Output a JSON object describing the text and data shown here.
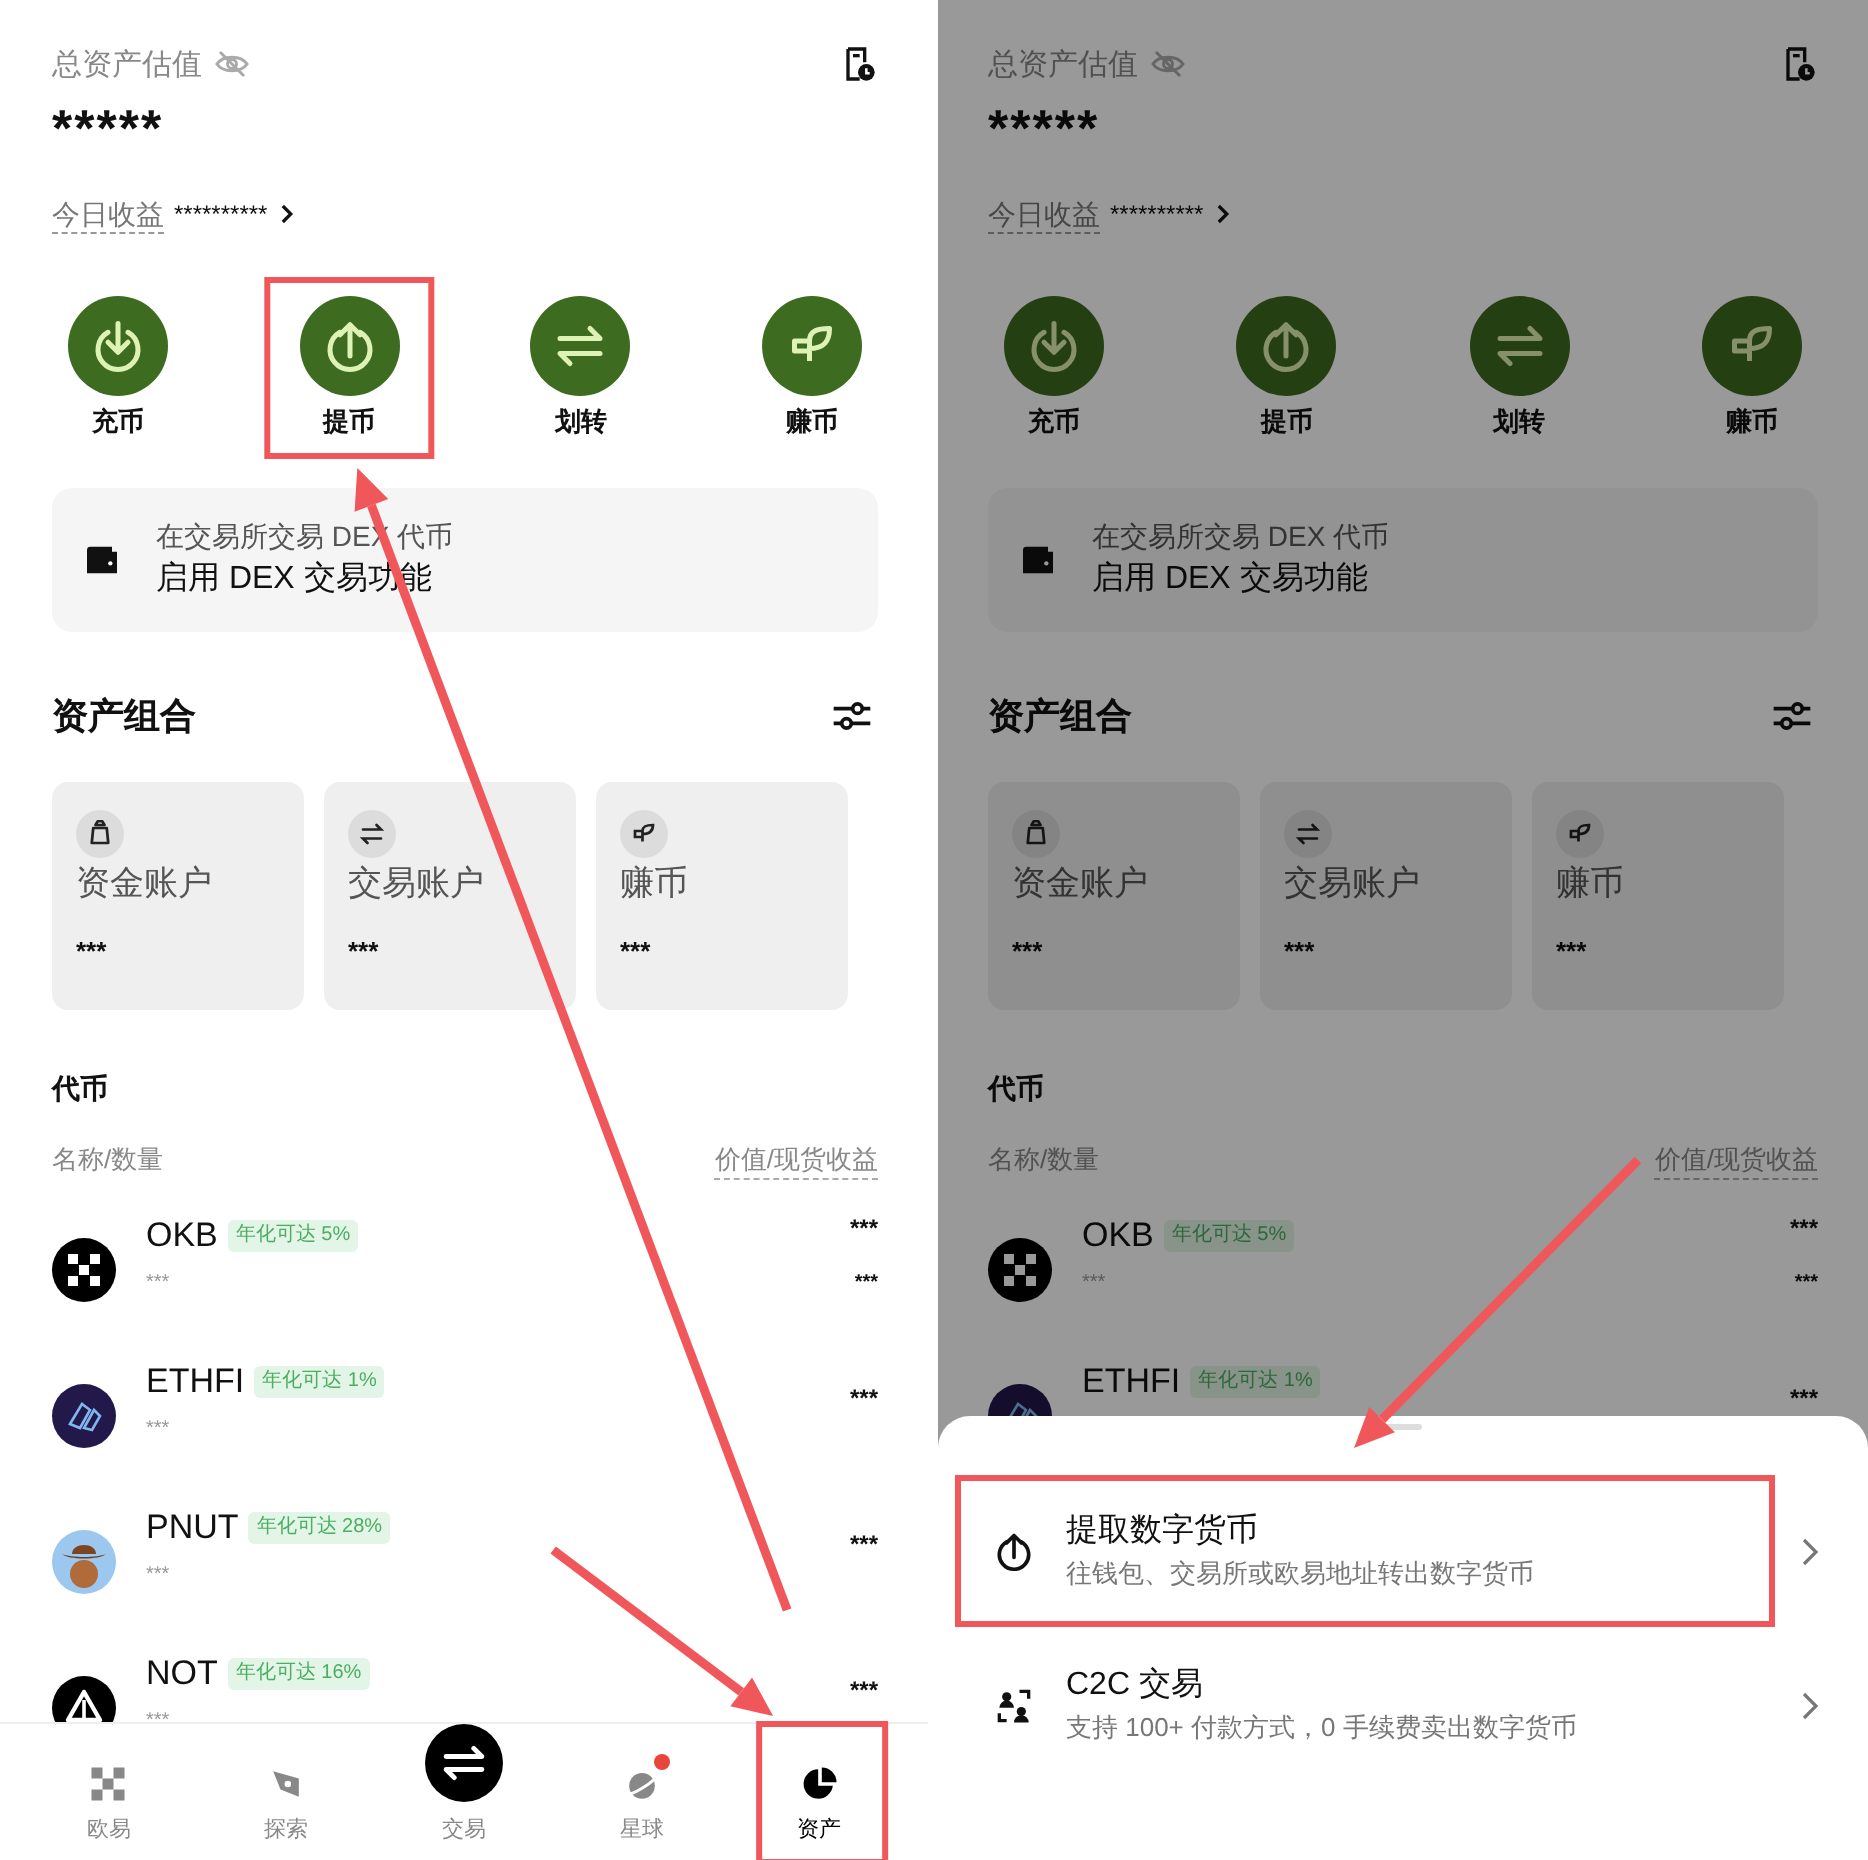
{
  "screens": [
    {
      "header": {
        "label": "总资产估值",
        "balance": "*****",
        "today_label": "今日收益",
        "today_value": "**********"
      },
      "actions": [
        {
          "kind": "deposit",
          "label": "充币"
        },
        {
          "kind": "withdraw",
          "label": "提币",
          "highlighted": true
        },
        {
          "kind": "transfer",
          "label": "划转"
        },
        {
          "kind": "earn",
          "label": "赚币"
        }
      ],
      "dex_card": {
        "subtitle": "在交易所交易 DEX 代币",
        "title": "启用 DEX 交易功能"
      },
      "portfolio": {
        "title": "资产组合",
        "accounts": [
          {
            "kind": "funding",
            "label": "资金账户",
            "value": "***"
          },
          {
            "kind": "trading",
            "label": "交易账户",
            "value": "***"
          },
          {
            "kind": "earn",
            "label": "赚币",
            "value": "***"
          }
        ]
      },
      "tokens": {
        "title": "代币",
        "columns": [
          "名称/数量",
          "价值/现货收益"
        ],
        "rows": [
          {
            "kind": "okb",
            "symbol": "OKB",
            "badge": "年化可达 5%",
            "amount": "***",
            "value": "***",
            "pnl": "***"
          },
          {
            "kind": "ethfi",
            "symbol": "ETHFI",
            "badge": "年化可达 1%",
            "amount": "***",
            "value": "***"
          },
          {
            "kind": "pnut",
            "symbol": "PNUT",
            "badge": "年化可达 28%",
            "amount": "***",
            "value": "***"
          },
          {
            "kind": "not",
            "symbol": "NOT",
            "badge": "年化可达 16%",
            "amount": "***",
            "value": "***"
          }
        ]
      },
      "bottom_nav": [
        {
          "kind": "home",
          "label": "欧易",
          "selected": false
        },
        {
          "kind": "explore",
          "label": "探索",
          "selected": false
        },
        {
          "kind": "trade",
          "label": "交易",
          "selected": false
        },
        {
          "kind": "planet",
          "label": "星球",
          "selected": false,
          "notification": true
        },
        {
          "kind": "assets",
          "label": "资产",
          "selected": true,
          "highlighted": true
        }
      ]
    },
    {
      "dimmed": true,
      "header": {
        "label": "总资产估值",
        "balance": "*****",
        "today_label": "今日收益",
        "today_value": "**********"
      },
      "actions": [
        {
          "kind": "deposit",
          "label": "充币"
        },
        {
          "kind": "withdraw",
          "label": "提币"
        },
        {
          "kind": "transfer",
          "label": "划转"
        },
        {
          "kind": "earn",
          "label": "赚币"
        }
      ],
      "dex_card": {
        "subtitle": "在交易所交易 DEX 代币",
        "title": "启用 DEX 交易功能"
      },
      "portfolio": {
        "title": "资产组合",
        "accounts": [
          {
            "kind": "funding",
            "label": "资金账户",
            "value": "***"
          },
          {
            "kind": "trading",
            "label": "交易账户",
            "value": "***"
          },
          {
            "kind": "earn",
            "label": "赚币",
            "value": "***"
          }
        ]
      },
      "tokens": {
        "title": "代币",
        "columns": [
          "名称/数量",
          "价值/现货收益"
        ],
        "rows": [
          {
            "kind": "okb",
            "symbol": "OKB",
            "badge": "年化可达 5%",
            "amount": "***",
            "value": "***",
            "pnl": "***"
          },
          {
            "kind": "ethfi",
            "symbol": "ETHFI",
            "badge": "年化可达 1%",
            "value": "***"
          }
        ]
      },
      "sheet": {
        "options": [
          {
            "kind": "withdraw",
            "title": "提取数字货币",
            "subtitle": "往钱包、交易所或欧易地址转出数字货币",
            "highlighted": true
          },
          {
            "kind": "c2c",
            "title": "C2C 交易",
            "subtitle": "支持 100+ 付款方式，0 手续费卖出数字货币"
          }
        ]
      }
    }
  ]
}
